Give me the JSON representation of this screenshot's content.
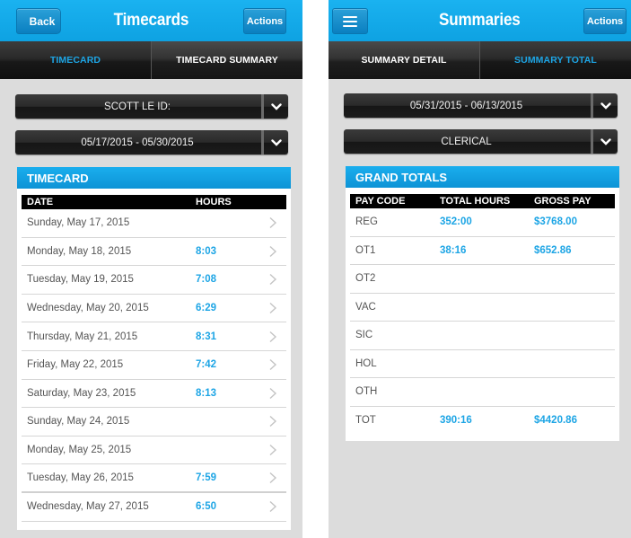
{
  "timecards_screen": {
    "header": {
      "back_label": "Back",
      "title": "Timecards",
      "actions_label": "Actions"
    },
    "tabs": [
      {
        "label": "TIMECARD",
        "active": true
      },
      {
        "label": "TIMECARD SUMMARY",
        "active": false
      }
    ],
    "employee_select": {
      "value": "SCOTT LE ID:"
    },
    "period_select": {
      "value": "05/17/2015 - 05/30/2015"
    },
    "card": {
      "title": "TIMECARD",
      "columns": [
        "DATE",
        "HOURS"
      ],
      "rows": [
        {
          "date": "Sunday, May 17, 2015",
          "hours": ""
        },
        {
          "date": "Monday, May 18, 2015",
          "hours": "8:03"
        },
        {
          "date": "Tuesday, May 19, 2015",
          "hours": "7:08"
        },
        {
          "date": "Wednesday, May 20, 2015",
          "hours": "6:29"
        },
        {
          "date": "Thursday, May 21, 2015",
          "hours": "8:31"
        },
        {
          "date": "Friday, May 22, 2015",
          "hours": "7:42"
        },
        {
          "date": "Saturday, May 23, 2015",
          "hours": "8:13"
        },
        {
          "date": "Sunday, May 24, 2015",
          "hours": ""
        },
        {
          "date": "Monday, May 25, 2015",
          "hours": ""
        },
        {
          "date": "Tuesday, May 26, 2015",
          "hours": "7:59"
        },
        {
          "date": "Wednesday, May 27, 2015",
          "hours": "6:50"
        }
      ]
    }
  },
  "summaries_screen": {
    "header": {
      "menu_icon": "hamburger-icon",
      "title": "Summaries",
      "actions_label": "Actions"
    },
    "tabs": [
      {
        "label": "SUMMARY DETAIL",
        "active": false
      },
      {
        "label": "SUMMARY TOTAL",
        "active": true
      }
    ],
    "period_select": {
      "value": "05/31/2015 - 06/13/2015"
    },
    "category_select": {
      "value": "CLERICAL"
    },
    "card": {
      "title": "GRAND TOTALS",
      "columns": [
        "PAY CODE",
        "TOTAL HOURS",
        "GROSS PAY"
      ],
      "rows": [
        {
          "code": "REG",
          "total_hours": "352:00",
          "gross_pay": "$3768.00"
        },
        {
          "code": "OT1",
          "total_hours": "38:16",
          "gross_pay": "$652.86"
        },
        {
          "code": "OT2",
          "total_hours": "",
          "gross_pay": ""
        },
        {
          "code": "VAC",
          "total_hours": "",
          "gross_pay": ""
        },
        {
          "code": "SIC",
          "total_hours": "",
          "gross_pay": ""
        },
        {
          "code": "HOL",
          "total_hours": "",
          "gross_pay": ""
        },
        {
          "code": "OTH",
          "total_hours": "",
          "gross_pay": ""
        },
        {
          "code": "TOT",
          "total_hours": "390:16",
          "gross_pay": "$4420.86"
        }
      ]
    }
  },
  "colors": {
    "accent_blue": "#1da5e5",
    "header_blue": "#12aaea",
    "background_gray": "#dcdcdc",
    "dark_control": "#1c1c1c"
  }
}
